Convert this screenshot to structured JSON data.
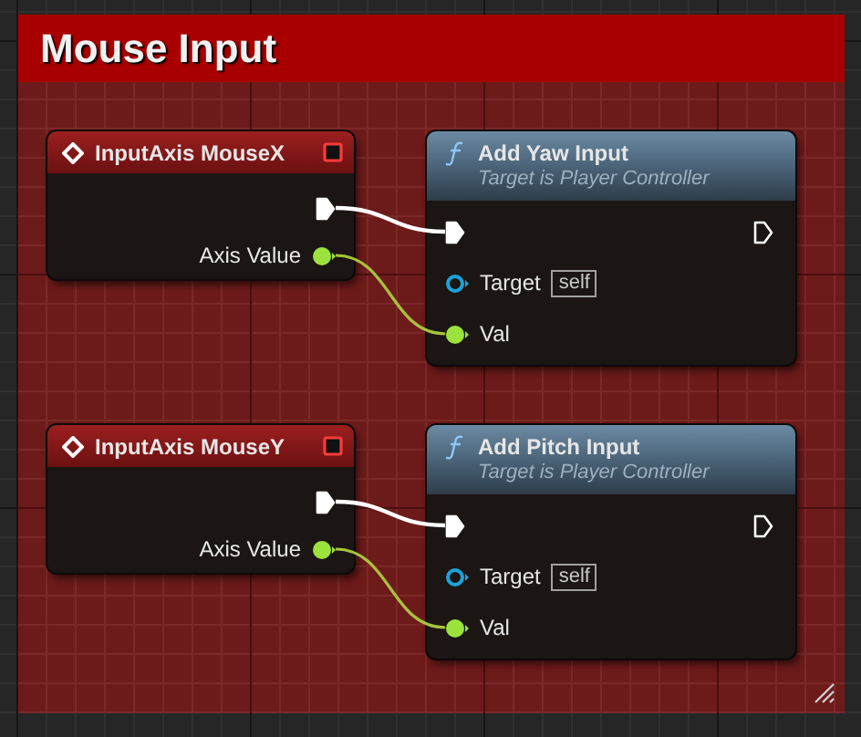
{
  "comment": {
    "title": "Mouse Input"
  },
  "rows": [
    {
      "event": {
        "title": "InputAxis MouseX",
        "output_label": "Axis Value"
      },
      "call": {
        "title": "Add Yaw Input",
        "subtitle": "Target is Player Controller",
        "target_label": "Target",
        "target_value": "self",
        "input_label": "Val"
      }
    },
    {
      "event": {
        "title": "InputAxis MouseY",
        "output_label": "Axis Value"
      },
      "call": {
        "title": "Add Pitch Input",
        "subtitle": "Target is Player Controller",
        "target_label": "Target",
        "target_value": "self",
        "input_label": "Val"
      }
    }
  ]
}
